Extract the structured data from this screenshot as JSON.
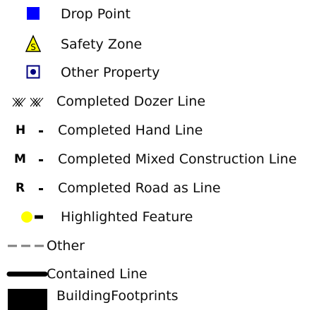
{
  "legend": {
    "items": [
      {
        "label": "Drop Point",
        "icon": "blue-square-icon",
        "color": "#0000ff"
      },
      {
        "label": "Safety Zone",
        "icon": "safety-zone-triangle-icon",
        "color": "#ffff00"
      },
      {
        "label": "Other Property",
        "icon": "dot-in-square-icon",
        "color": "#00007f"
      },
      {
        "label": "Completed Dozer Line",
        "icon": "dozer-line-icon",
        "color": "#000000"
      },
      {
        "label": "Completed Hand Line",
        "icon": "hand-line-icon",
        "letter": "H"
      },
      {
        "label": "Completed Mixed Construction Line",
        "icon": "mixed-line-icon",
        "letter": "M"
      },
      {
        "label": "Completed Road as Line",
        "icon": "road-line-icon",
        "letter": "R"
      },
      {
        "label": "Highlighted Feature",
        "icon": "highlight-dot-dash-icon",
        "color": "#ffff00"
      },
      {
        "label": "Other",
        "icon": "dashed-gray-line-icon",
        "color": "#7f7f7f"
      },
      {
        "label": "Contained Line",
        "icon": "thick-black-line-icon",
        "color": "#000000"
      },
      {
        "label": "BuildingFootprints",
        "icon": "black-rectangle-icon",
        "color": "#000000"
      }
    ]
  }
}
